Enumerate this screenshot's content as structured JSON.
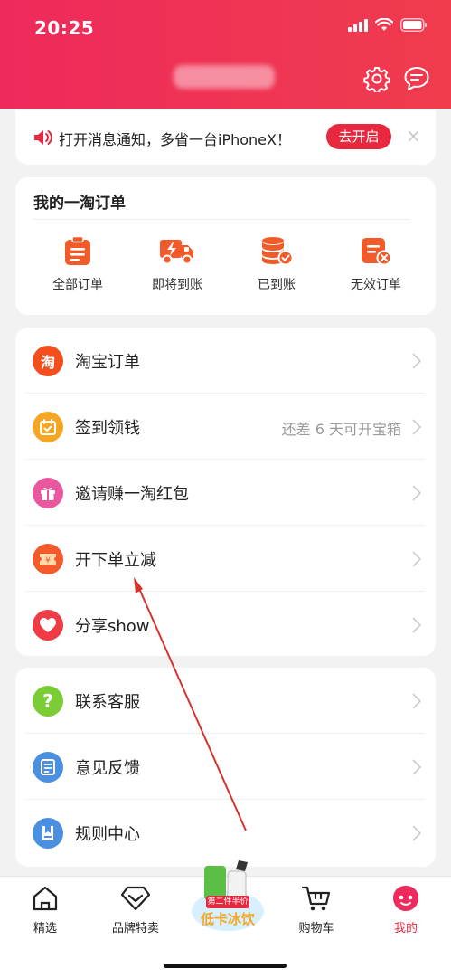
{
  "status": {
    "time": "20:25"
  },
  "notice": {
    "text": "打开消息通知，多省一台iPhoneX！",
    "button": "去开启",
    "close": "×"
  },
  "orders": {
    "title": "我的一淘订单",
    "items": [
      {
        "label": "全部订单",
        "icon": "clipboard-icon"
      },
      {
        "label": "即将到账",
        "icon": "truck-icon"
      },
      {
        "label": "已到账",
        "icon": "coins-check-icon"
      },
      {
        "label": "无效订单",
        "icon": "invalid-order-icon"
      }
    ]
  },
  "menu1": [
    {
      "label": "淘宝订单",
      "icon": "taobao-icon",
      "iconText": "淘",
      "color": "#f24e1e",
      "hint": ""
    },
    {
      "label": "签到领钱",
      "icon": "checkin-icon",
      "color": "#f5a623",
      "hint": "还差 6 天可开宝箱"
    },
    {
      "label": "邀请赚一淘红包",
      "icon": "gift-icon",
      "color": "#e9579e",
      "hint": ""
    },
    {
      "label": "开下单立减",
      "icon": "coupon-icon",
      "color": "#f35a2c",
      "hint": ""
    },
    {
      "label": "分享show",
      "icon": "heart-icon",
      "color": "#ee3b45",
      "hint": ""
    }
  ],
  "menu2": [
    {
      "label": "联系客服",
      "icon": "question-icon",
      "iconText": "?",
      "color": "#7ccc35"
    },
    {
      "label": "意见反馈",
      "icon": "feedback-icon",
      "color": "#4a8fe0"
    },
    {
      "label": "规则中心",
      "icon": "rules-icon",
      "color": "#4a8fe0"
    }
  ],
  "tabs": [
    {
      "label": "精选",
      "icon": "home-icon"
    },
    {
      "label": "品牌特卖",
      "icon": "diamond-icon"
    },
    {
      "label": "购物车",
      "icon": "cart-icon"
    },
    {
      "label": "我的",
      "icon": "profile-face-icon"
    }
  ],
  "promo": {
    "badge": "第二件半价",
    "text": "低卡冰饮"
  },
  "colors": {
    "brand": "#ef2f55",
    "active_tab": "#e8283f"
  }
}
